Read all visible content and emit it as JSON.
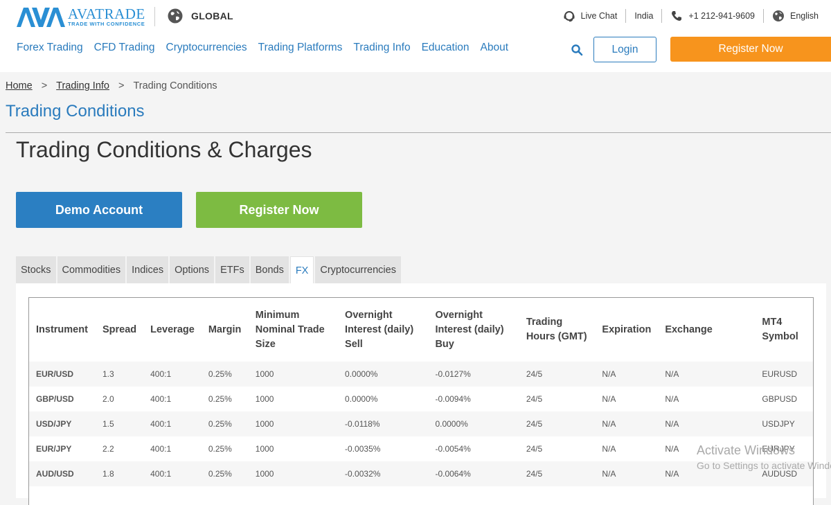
{
  "header": {
    "logo_name": "AVATRADE",
    "logo_tagline": "TRADE WITH CONFIDENCE",
    "region": "GLOBAL",
    "topbar": {
      "live_chat": "Live Chat",
      "country": "India",
      "phone": "+1 212-941-9609",
      "language": "English"
    },
    "nav": [
      "Forex Trading",
      "CFD Trading",
      "Cryptocurrencies",
      "Trading Platforms",
      "Trading Info",
      "Education",
      "About"
    ],
    "login_label": "Login",
    "register_label": "Register Now"
  },
  "breadcrumb": {
    "home": "Home",
    "sep": ">",
    "trading_info": "Trading Info",
    "current": "Trading Conditions"
  },
  "page_subtitle": "Trading Conditions",
  "main_title": "Trading Conditions & Charges",
  "buttons": {
    "demo": "Demo Account",
    "register": "Register Now"
  },
  "tabs": [
    "Stocks",
    "Commodities",
    "Indices",
    "Options",
    "ETFs",
    "Bonds",
    "FX",
    "Cryptocurrencies"
  ],
  "active_tab": "FX",
  "table": {
    "headers": [
      "Instrument",
      "Spread",
      "Leverage",
      "Margin",
      "Minimum Nominal Trade Size",
      "Overnight Interest (daily) Sell",
      "Overnight Interest (daily) Buy",
      "Trading Hours (GMT)",
      "Expiration",
      "Exchange",
      "MT4 Symbol"
    ],
    "rows": [
      [
        "EUR/USD",
        "1.3",
        "400:1",
        "0.25%",
        "1000",
        "0.0000%",
        "-0.0127%",
        "24/5",
        "N/A",
        "N/A",
        "EURUSD"
      ],
      [
        "GBP/USD",
        "2.0",
        "400:1",
        "0.25%",
        "1000",
        "0.0000%",
        "-0.0094%",
        "24/5",
        "N/A",
        "N/A",
        "GBPUSD"
      ],
      [
        "USD/JPY",
        "1.5",
        "400:1",
        "0.25%",
        "1000",
        "-0.0118%",
        "0.0000%",
        "24/5",
        "N/A",
        "N/A",
        "USDJPY"
      ],
      [
        "EUR/JPY",
        "2.2",
        "400:1",
        "0.25%",
        "1000",
        "-0.0035%",
        "-0.0054%",
        "24/5",
        "N/A",
        "N/A",
        "EURJPY"
      ],
      [
        "AUD/USD",
        "1.8",
        "400:1",
        "0.25%",
        "1000",
        "-0.0032%",
        "-0.0064%",
        "24/5",
        "N/A",
        "N/A",
        "AUDUSD"
      ]
    ]
  },
  "watermark": {
    "title": "Activate Windows",
    "subtitle": "Go to Settings to activate Windows."
  },
  "colors": {
    "brand_blue": "#2a7bbd",
    "orange": "#f7941d",
    "demo_blue": "#2b7fc2",
    "green": "#7dbb42"
  }
}
